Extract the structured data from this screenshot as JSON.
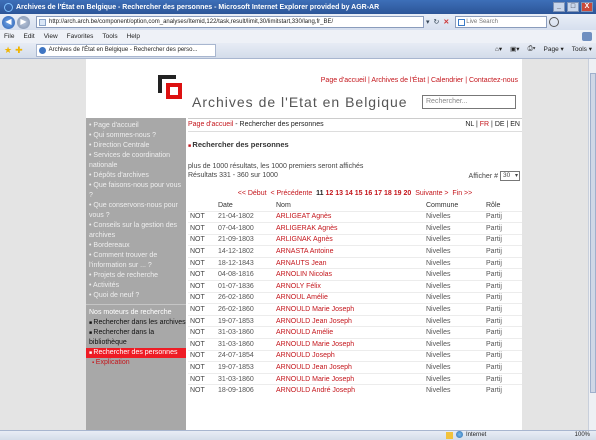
{
  "window": {
    "title": "Archives de l'État en Belgique - Rechercher des personnes - Microsoft Internet Explorer provided by AGR-AR",
    "min": "_",
    "max": "□",
    "close": "X"
  },
  "address": {
    "url": "http://arch.arch.be/component/option,com_analyses/Itemid,122/task,result/limit,30/limitstart,330/lang,fr_BE/",
    "search_placeholder": "Live Search"
  },
  "menu": [
    "File",
    "Edit",
    "View",
    "Favorites",
    "Tools",
    "Help"
  ],
  "tab": {
    "label": "Archives de l'État en Belgique - Rechercher des perso..."
  },
  "tab_tools": [
    "Page ▾",
    "Tools ▾"
  ],
  "site": {
    "toplinks": "Page d'accueil | Archives de l'État | Calendrier | Contactez-nous",
    "title": "Archives de l'Etat en Belgique",
    "search_placeholder": "Rechercher..."
  },
  "sidebar": {
    "items": [
      "Page d'accueil",
      "Qui sommes-nous ?",
      "Direction Centrale",
      "Services de coordination nationale",
      "Dépôts d'archives",
      "Que faisons-nous pour vous ?",
      "Que conservons-nous pour vous ?",
      "Conseils sur la gestion des archives",
      "Bordereaux",
      "Comment trouver de l'information sur ... ?",
      "Projets de recherche",
      "Activités",
      "Quoi de neuf ?"
    ],
    "section": "Nos moteurs de recherche",
    "subs": [
      "Rechercher dans les archives",
      "Rechercher dans la bibliothèque",
      "Rechercher des personnes"
    ],
    "subsub": "Explication"
  },
  "breadcrumb": {
    "home": "Page d'accueil",
    "sep": " - ",
    "current": "Rechercher des personnes"
  },
  "lang": {
    "nl": "NL",
    "fr": "FR",
    "de": "DE",
    "en": "EN"
  },
  "heading": "Rechercher des personnes",
  "info": {
    "line1": "plus de 1000 résultats, les 1000 premiers seront affichés",
    "line2": "Résultats 331 - 360 sur 1000"
  },
  "afficher": {
    "label": "Afficher #",
    "value": "30"
  },
  "pager": {
    "first": "<< Début",
    "prev": "< Précédente",
    "pages": [
      "11",
      "12",
      "13",
      "14",
      "15",
      "16",
      "17",
      "18",
      "19",
      "20"
    ],
    "current": "11",
    "next": "Suivante >",
    "last": "Fin >>"
  },
  "table": {
    "headers": [
      "",
      "Date",
      "Nom",
      "Commune",
      "Rôle"
    ],
    "rows": [
      [
        "NOT",
        "21-04-1802",
        "ARLIGEAT Agnès",
        "Nivelles",
        "Partij"
      ],
      [
        "NOT",
        "07-04-1800",
        "ARLIGERAK Agnès",
        "Nivelles",
        "Partij"
      ],
      [
        "NOT",
        "21-09-1803",
        "ARLIGNAK Agnès",
        "Nivelles",
        "Partij"
      ],
      [
        "NOT",
        "14-12-1802",
        "ARNASTA Antoine",
        "Nivelles",
        "Partij"
      ],
      [
        "NOT",
        "18-12-1843",
        "ARNAUTS Jean",
        "Nivelles",
        "Partij"
      ],
      [
        "NOT",
        "04-08-1816",
        "ARNOLIN Nicolas",
        "Nivelles",
        "Partij"
      ],
      [
        "NOT",
        "01-07-1836",
        "ARNOLY Félix",
        "Nivelles",
        "Partij"
      ],
      [
        "NOT",
        "26-02-1860",
        "ARNOUL Amélie",
        "Nivelles",
        "Partij"
      ],
      [
        "NOT",
        "26-02-1860",
        "ARNOULD Marie Joseph",
        "Nivelles",
        "Partij"
      ],
      [
        "NOT",
        "19-07-1853",
        "ARNOULD Jean Joseph",
        "Nivelles",
        "Partij"
      ],
      [
        "NOT",
        "31-03-1860",
        "ARNOULD Amélie",
        "Nivelles",
        "Partij"
      ],
      [
        "NOT",
        "31-03-1860",
        "ARNOULD Marie Joseph",
        "Nivelles",
        "Partij"
      ],
      [
        "NOT",
        "24-07-1854",
        "ARNOULD Joseph",
        "Nivelles",
        "Partij"
      ],
      [
        "NOT",
        "19-07-1853",
        "ARNOULD Jean Joseph",
        "Nivelles",
        "Partij"
      ],
      [
        "NOT",
        "31-03-1860",
        "ARNOULD Marie Joseph",
        "Nivelles",
        "Partij"
      ],
      [
        "NOT",
        "18-09-1806",
        "ARNOULD André Joseph",
        "Nivelles",
        "Partij"
      ]
    ]
  },
  "status": {
    "zone": "Internet",
    "zoom": "100%"
  }
}
